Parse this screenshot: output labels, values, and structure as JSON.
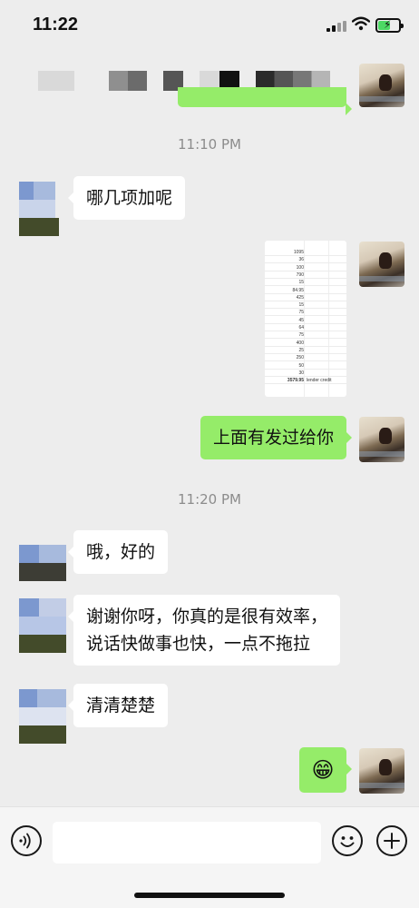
{
  "status_bar": {
    "time": "11:22",
    "battery_level": 0.6
  },
  "timestamps": [
    "11:10 PM",
    "11:20 PM"
  ],
  "messages": [
    {
      "sender": "contact",
      "text": "哪几项加呢"
    },
    {
      "sender": "me",
      "type": "image"
    },
    {
      "sender": "me",
      "text": "上面有发过给你"
    },
    {
      "sender": "contact",
      "text": "哦，好的"
    },
    {
      "sender": "contact",
      "lines": [
        "谢谢你呀，你真的是很有效率，",
        "说话快做事也快，一点不拖拉"
      ]
    },
    {
      "sender": "contact",
      "text": "清清楚楚"
    },
    {
      "sender": "me",
      "type": "emoji",
      "text": "😁"
    }
  ],
  "spreadsheet": {
    "rows": [
      "1095",
      "36",
      "100",
      "790",
      "15",
      "84.95",
      "425",
      "15",
      "75",
      "45",
      "64",
      "75",
      "400",
      "25",
      "250",
      "50",
      "30"
    ],
    "total": "3579.95",
    "total_note": "lender credit"
  },
  "input_bar": {
    "placeholder": ""
  },
  "icons": {
    "voice": "voice-icon",
    "emoji": "emoji-icon",
    "plus": "plus-icon",
    "wifi": "wifi-icon",
    "signal": "signal-icon",
    "battery": "battery-icon"
  },
  "colors": {
    "background": "#ededed",
    "my_bubble": "#95ec69",
    "their_bubble": "#ffffff",
    "timestamp": "#8c8c8c"
  }
}
